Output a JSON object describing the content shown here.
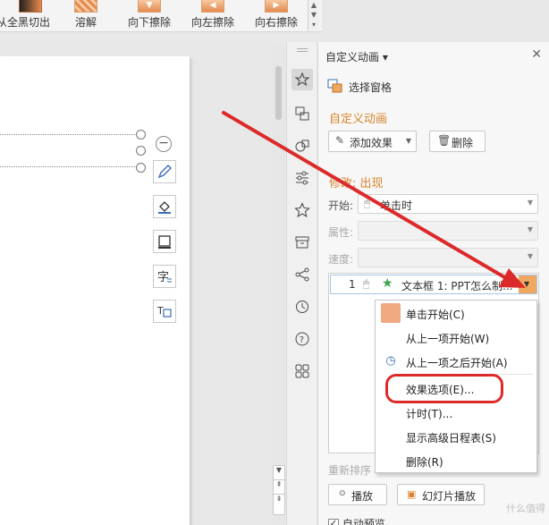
{
  "ribbon": {
    "items": [
      {
        "label": "从全黑切出"
      },
      {
        "label": "溶解"
      },
      {
        "label": "向下擦除"
      },
      {
        "label": "向左擦除"
      },
      {
        "label": "向右擦除"
      }
    ]
  },
  "pane": {
    "title": "自定义动画 ▾",
    "selection_pane": "选择窗格",
    "section_custom": "自定义动画",
    "add_effect": "添加效果",
    "delete": "删除",
    "section_modify": "修改: 出现",
    "start_label": "开始:",
    "start_value": "单击时",
    "property_label": "属性:",
    "speed_label": "速度:",
    "list_item": {
      "index": "1",
      "text": "文本框 1: PPT怎么制..."
    },
    "reorder": "重新排序",
    "play": "播放",
    "slideshow": "幻灯片播放",
    "autopreview": "自动预览"
  },
  "menu": {
    "items": [
      {
        "label": "单击开始(C)"
      },
      {
        "label": "从上一项开始(W)"
      },
      {
        "label": "从上一项之后开始(A)"
      },
      {
        "label": "效果选项(E)..."
      },
      {
        "label": "计时(T)..."
      },
      {
        "label": "显示高级日程表(S)"
      },
      {
        "label": "删除(R)"
      }
    ]
  },
  "colors": {
    "accent_orange": "#d9832c",
    "annotation_red": "#dc2a2a"
  },
  "watermark": "什么值得"
}
